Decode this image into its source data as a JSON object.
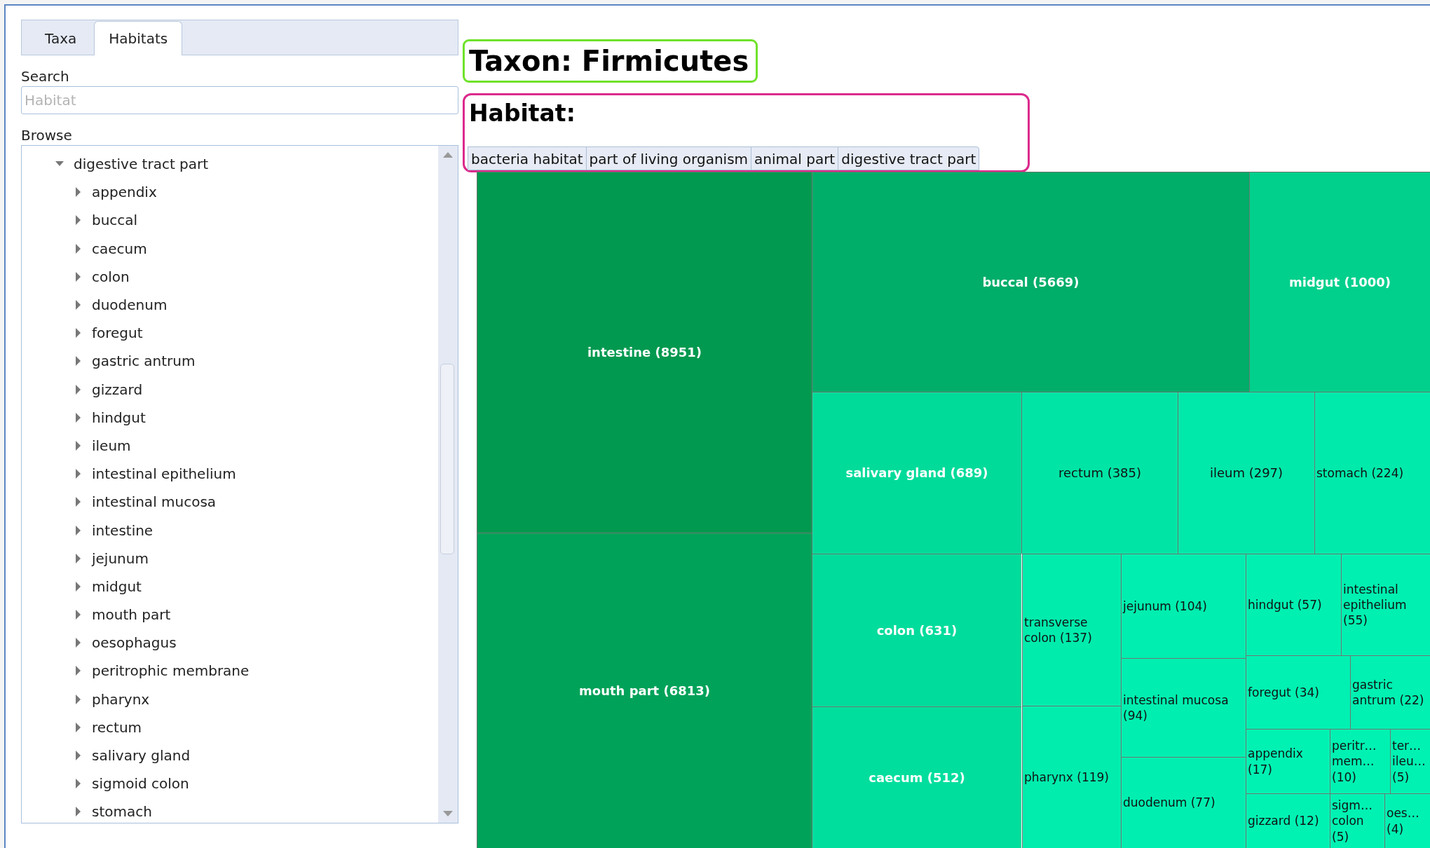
{
  "tabs": [
    {
      "label": "Taxa",
      "selected": false
    },
    {
      "label": "Habitats",
      "selected": true
    }
  ],
  "search": {
    "label": "Search",
    "placeholder": "Habitat"
  },
  "browse": {
    "label": "Browse",
    "tree": [
      {
        "label": "digestive tract part",
        "expanded": true,
        "children": [
          {
            "label": "appendix",
            "expanded": false
          },
          {
            "label": "buccal",
            "expanded": false
          },
          {
            "label": "caecum",
            "expanded": false
          },
          {
            "label": "colon",
            "expanded": false
          },
          {
            "label": "duodenum",
            "expanded": false
          },
          {
            "label": "foregut",
            "expanded": false
          },
          {
            "label": "gastric antrum",
            "expanded": false
          },
          {
            "label": "gizzard",
            "expanded": false
          },
          {
            "label": "hindgut",
            "expanded": false
          },
          {
            "label": "ileum",
            "expanded": false
          },
          {
            "label": "intestinal epithelium",
            "expanded": false
          },
          {
            "label": "intestinal mucosa",
            "expanded": false
          },
          {
            "label": "intestine",
            "expanded": false
          },
          {
            "label": "jejunum",
            "expanded": false
          },
          {
            "label": "midgut",
            "expanded": false
          },
          {
            "label": "mouth part",
            "expanded": false
          },
          {
            "label": "oesophagus",
            "expanded": false
          },
          {
            "label": "peritrophic membrane",
            "expanded": false
          },
          {
            "label": "pharynx",
            "expanded": false
          },
          {
            "label": "rectum",
            "expanded": false
          },
          {
            "label": "salivary gland",
            "expanded": false
          },
          {
            "label": "sigmoid colon",
            "expanded": false
          },
          {
            "label": "stomach",
            "expanded": false
          }
        ]
      }
    ]
  },
  "title": "Taxon: Firmicutes",
  "habitat": {
    "label": "Habitat:",
    "breadcrumb": [
      "bacteria habitat",
      "part of living organism",
      "animal part",
      "digestive tract part"
    ]
  },
  "treemap": {
    "cells": [
      {
        "label": "intestine (8951)",
        "color": "#00994f"
      },
      {
        "label": "mouth part (6813)",
        "color": "#00a259"
      },
      {
        "label": "buccal (5669)",
        "color": "#00ad69"
      },
      {
        "label": "midgut (1000)",
        "color": "#00d08c"
      },
      {
        "label": "salivary gland (689)",
        "color": "#00db9a"
      },
      {
        "label": "rectum (385)",
        "color": "#00e5a6"
      },
      {
        "label": "ileum (297)",
        "color": "#00e8aa"
      },
      {
        "label": "stomach (224)",
        "color": "#00eaab"
      },
      {
        "label": "colon (631)",
        "color": "#00dc9b"
      },
      {
        "label": "caecum (512)",
        "color": "#00de9d"
      },
      {
        "label": "transverse colon (137)",
        "color": "#00ecad"
      },
      {
        "label": "pharynx (119)",
        "color": "#00edae"
      },
      {
        "label": "jejunum (104)",
        "color": "#00eeaf"
      },
      {
        "label": "intestinal mucosa (94)",
        "color": "#00efb0"
      },
      {
        "label": "duodenum (77)",
        "color": "#00efb0"
      },
      {
        "label": "hindgut (57)",
        "color": "#00f0b1"
      },
      {
        "label": "intestinal epithelium (55)",
        "color": "#00f0b1"
      },
      {
        "label": "foregut (34)",
        "color": "#00f1b2"
      },
      {
        "label": "gastric antrum (22)",
        "color": "#00f1b2"
      },
      {
        "label": "appendix (17)",
        "color": "#00f2b3"
      },
      {
        "label": "peritr… mem… (10)",
        "color": "#00f2b3"
      },
      {
        "label": "ter… ileu… (5)",
        "color": "#00f2b3"
      },
      {
        "label": "gizzard (12)",
        "color": "#00f2b3"
      },
      {
        "label": "sigm… colon (5)",
        "color": "#00f2b3"
      },
      {
        "label": "oes… (4)",
        "color": "#00f2b3"
      }
    ]
  }
}
